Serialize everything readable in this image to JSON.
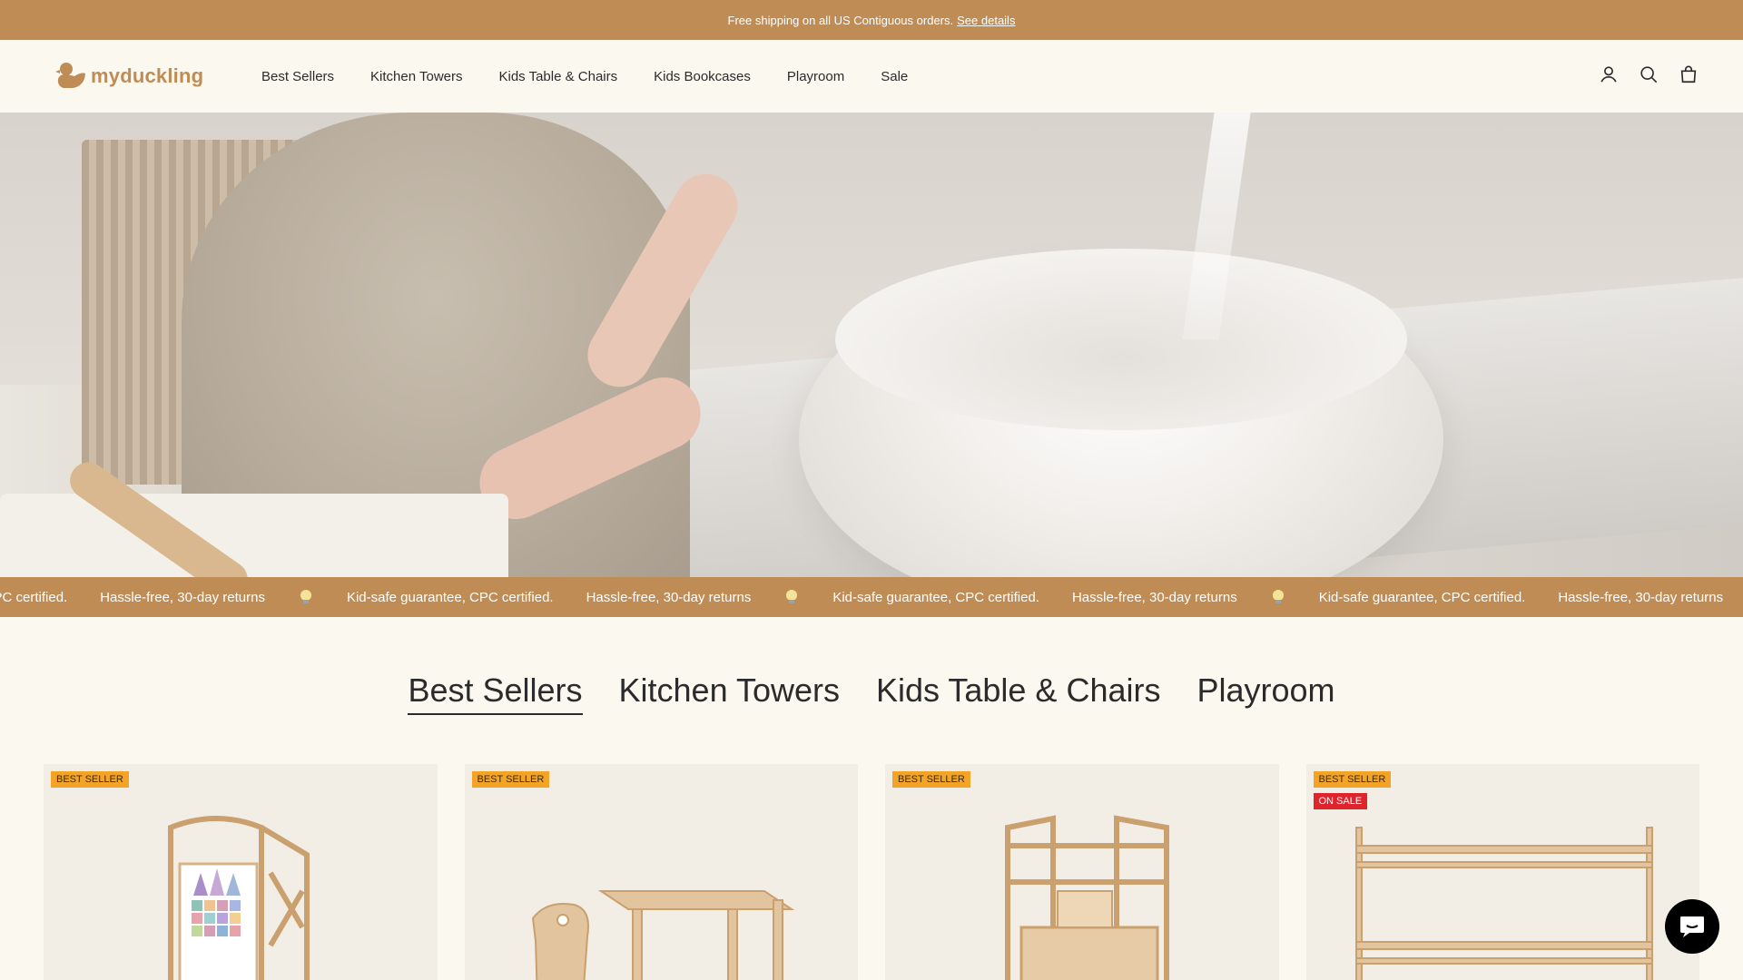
{
  "announcement": {
    "text": "Free shipping on all US Contiguous orders.",
    "link_label": "See details"
  },
  "brand": {
    "name": "myduckling",
    "accent_color": "#c08c55"
  },
  "nav": {
    "items": [
      {
        "label": "Best Sellers"
      },
      {
        "label": "Kitchen Towers"
      },
      {
        "label": "Kids Table & Chairs"
      },
      {
        "label": "Kids Bookcases"
      },
      {
        "label": "Playroom"
      },
      {
        "label": "Sale"
      }
    ]
  },
  "header_icons": [
    "account-icon",
    "search-icon",
    "cart-icon"
  ],
  "marquee": {
    "items": [
      "e, CPC certified.",
      "Hassle-free, 30-day returns",
      "Kid-safe guarantee, CPC certified.",
      "Hassle-free, 30-day returns",
      "Kid-safe guarantee, CPC certified.",
      "Hassle-free, 30-day returns",
      "Kid-safe guarantee, CPC certified.",
      "Hassle-free, 30-day returns"
    ],
    "icon": "lightbulb-icon"
  },
  "collection_tabs": {
    "items": [
      {
        "label": "Best Sellers",
        "active": true
      },
      {
        "label": "Kitchen Towers",
        "active": false
      },
      {
        "label": "Kids Table & Chairs",
        "active": false
      },
      {
        "label": "Playroom",
        "active": false
      }
    ]
  },
  "products": [
    {
      "badges": [
        "BEST SELLER"
      ],
      "image": "learning-tower-with-chalkboard"
    },
    {
      "badges": [
        "BEST SELLER"
      ],
      "image": "kids-table-and-chair"
    },
    {
      "badges": [
        "BEST SELLER"
      ],
      "image": "kitchen-tower"
    },
    {
      "badges": [
        "BEST SELLER",
        "ON SALE"
      ],
      "image": "bookcase"
    }
  ],
  "colors": {
    "badge_best_seller": "#f3a326",
    "badge_on_sale": "#e0242b",
    "page_background": "#fbf8ef"
  },
  "chat": {
    "icon": "chat-bubble-icon"
  }
}
